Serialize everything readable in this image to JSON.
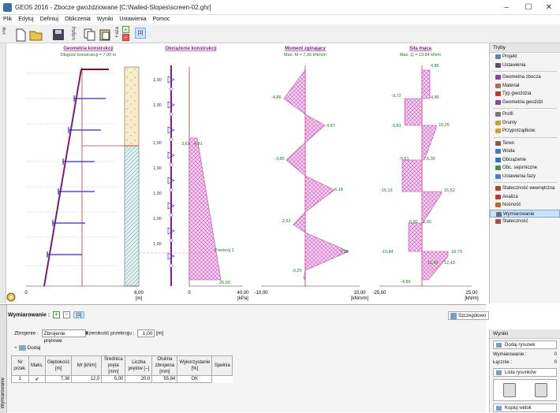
{
  "window": {
    "title": "GEO5 2016 - Zbocze gwoździowane [C:\\Nailed-Slopes\\screen-02.ghr]"
  },
  "menu": [
    "Plik",
    "Edytuj",
    "Definiuj",
    "Obliczenia",
    "Wyniki",
    "Ustawienia",
    "Pomoc"
  ],
  "toolbar": {
    "plik_label": "Plik",
    "edytuj_label": "Edytuj",
    "faza_label": "Faza",
    "stage_number": "[1]"
  },
  "drawing": {
    "geometry_title": "Geometria konstrukcji",
    "geometry_sub": "Długość konstrukcji = 7,00 m",
    "load_title": "Obciążenie konstrukcji",
    "moment_title": "Moment zginający",
    "moment_sub": "Max. M = 7,36 kNm/m",
    "shear_title": "Siła tnąca",
    "shear_sub": "Max. Q = 19,84 kN/m",
    "spacing_labels": [
      "1,00",
      "1,00",
      "1,00",
      "1,00",
      "1,00",
      "1,00",
      "1,00"
    ],
    "load_values": [
      "3,81",
      "4,81",
      "26,00"
    ],
    "section_label": "Przekrój 1",
    "moment_values": [
      "-4,86",
      "4,87",
      "-3,80",
      "6,18",
      "-2,62",
      "7,36",
      "-0,20"
    ],
    "shear_values": [
      "4,86",
      "-9,72",
      "4,86",
      "-9,83",
      "10,25",
      "-5,61",
      "6,00",
      "-15,13",
      "15,52",
      "-0,90",
      "1,30",
      "-19,84",
      "18,79",
      "11,43",
      "12,43",
      "-4,86"
    ],
    "axis_geo": {
      "start": "0",
      "end": "6,00",
      "unit": "[m]"
    },
    "axis_load": {
      "start": "0",
      "end": "40,00",
      "unit": "[kPa]"
    },
    "axis_moment": {
      "start": "-10,00",
      "end": "10,00",
      "unit": "[kNm/m]"
    },
    "axis_shear": {
      "start": "-25,00",
      "end": "25,00",
      "unit": "[kN/m]"
    }
  },
  "right_panel": {
    "title": "Tryby",
    "items": [
      {
        "label": "Projekt",
        "color": "#6a7fa8"
      },
      {
        "label": "Ustawienia",
        "color": "#555"
      },
      {
        "label": "Geometria zbocza",
        "color": "#9b3ab0"
      },
      {
        "label": "Materiał",
        "color": "#9a7a4a"
      },
      {
        "label": "Typ gwoździa",
        "color": "#c0392b"
      },
      {
        "label": "Geometria gwoździ",
        "color": "#8e44ad"
      },
      {
        "label": "Profil",
        "color": "#777"
      },
      {
        "label": "Grunty",
        "color": "#c9a227"
      },
      {
        "label": "Przyporządkow.",
        "color": "#c9a227"
      },
      {
        "label": "Teren",
        "color": "#8a5a3a"
      },
      {
        "label": "Woda",
        "color": "#2f7fd8"
      },
      {
        "label": "Obciążenie",
        "color": "#2f6fd8"
      },
      {
        "label": "Obc. sejsmiczne",
        "color": "#4a8a4a"
      },
      {
        "label": "Ustawienia fazy",
        "color": "#4a7ac8"
      },
      {
        "label": "Stateczność wewnętrzna",
        "color": "#b04a2a"
      },
      {
        "label": "Analiza",
        "color": "#c0392b"
      },
      {
        "label": "Nośność",
        "color": "#c06a2a"
      },
      {
        "label": "Wymiarowanie",
        "color": "#6a6a8a"
      },
      {
        "label": "Stateczność",
        "color": "#b04a4a"
      }
    ],
    "active_index": 17
  },
  "bottom": {
    "tab_label": "Wymiarowanie",
    "title": "Wymiarowanie :",
    "stage_btn": "[1]",
    "detail_btn": "Szczegółowo",
    "reinforce_label": "Zbrojenie :",
    "reinforce_value": "Zbrojenie prętowe",
    "width_label": "Szerokość przekroju :",
    "width_value": "1,00",
    "width_unit": "[m]",
    "add_btn": "Dodaj",
    "columns": [
      "Nr przek.",
      "Maks.",
      "Głębokość [m]",
      "Mr [kNm]",
      "Średnica pręta [mm]",
      "Liczba prętów [–]",
      "Otulina zbrojenia [mm]",
      "Wykorzystanie [%]",
      "Spełnia"
    ],
    "rows": [
      [
        "1",
        "✔",
        "7,36",
        "12,0",
        "5,00",
        "20,0",
        "55,84",
        "OK"
      ]
    ]
  },
  "results": {
    "title": "Wyniki",
    "add_drawing": "Dodaj rysunek",
    "wymiarowanie_label": "Wymiarowanie :",
    "wymiarowanie_count": "0",
    "lacznie_label": "Łącznie :",
    "lacznie_count": "0",
    "list_btn": "Lista rysunków",
    "copy_btn": "Kopiuj widok"
  }
}
